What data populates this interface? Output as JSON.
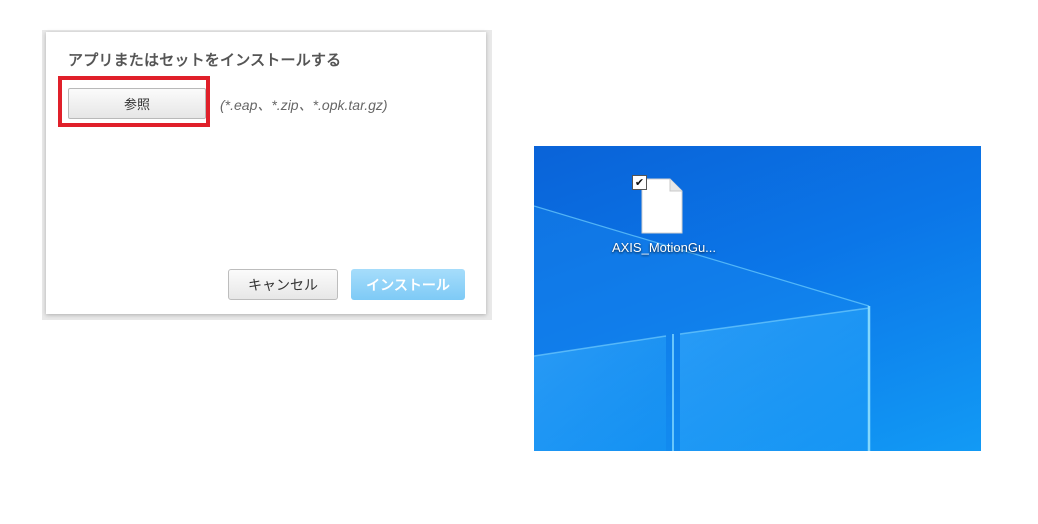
{
  "dialog": {
    "title": "アプリまたはセットをインストールする",
    "browse_label": "参照",
    "file_types_hint": "(*.eap、*.zip、*.opk.tar.gz)",
    "cancel_label": "キャンセル",
    "install_label": "インストール"
  },
  "desktop": {
    "file_name": "AXIS_MotionGu...",
    "file_selected": true,
    "check_mark": "✔"
  },
  "colors": {
    "highlight": "#e0202a",
    "install_button": "#7ecaf6",
    "desktop_blue": "#0b76e8"
  }
}
